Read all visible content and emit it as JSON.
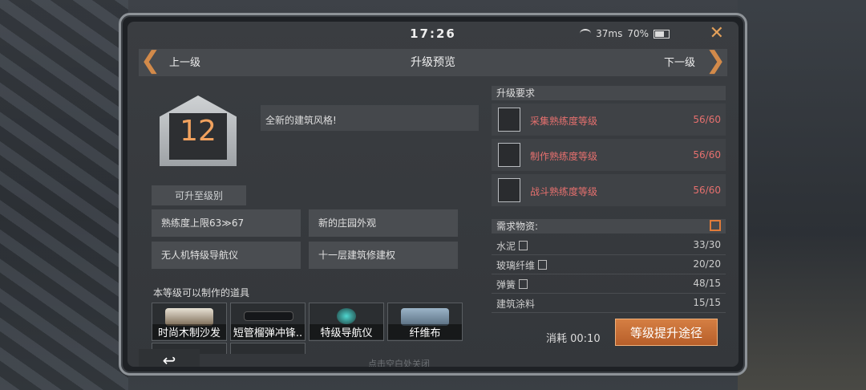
{
  "status": {
    "time": "17:26",
    "ping": "37ms",
    "battery": "70%"
  },
  "nav": {
    "prev": "上一级",
    "title": "升级预览",
    "next": "下一级"
  },
  "level": {
    "number": "12",
    "sub": "可升至级别",
    "style": "全新的建筑风格!"
  },
  "features": [
    "熟练度上限63≫67",
    "新的庄园外观",
    "无人机特级导航仪",
    "十一层建筑修建权"
  ],
  "items": {
    "title": "本等级可以制作的道具",
    "list": [
      "时尚木制沙发",
      "短管榴弹冲锋..",
      "特级导航仪",
      "纤维布"
    ]
  },
  "requirements": {
    "title": "升级要求",
    "rows": [
      {
        "label": "采集熟练度等级",
        "value": "56/60"
      },
      {
        "label": "制作熟练度等级",
        "value": "56/60"
      },
      {
        "label": "战斗熟练度等级",
        "value": "56/60"
      }
    ]
  },
  "materials": {
    "title": "需求物资:",
    "rows": [
      {
        "label": "水泥",
        "value": "33/30"
      },
      {
        "label": "玻璃纤维",
        "value": "20/20"
      },
      {
        "label": "弹簧",
        "value": "48/15"
      },
      {
        "label": "建筑涂料",
        "value": "15/15"
      }
    ]
  },
  "footer": {
    "cost": "消耗 00:10",
    "upgrade_label": "等级提升途径",
    "hint": "点击空白处关闭",
    "back_icon": "return-icon"
  },
  "colors": {
    "accent": "#d57f43",
    "warning": "#e6706e"
  }
}
